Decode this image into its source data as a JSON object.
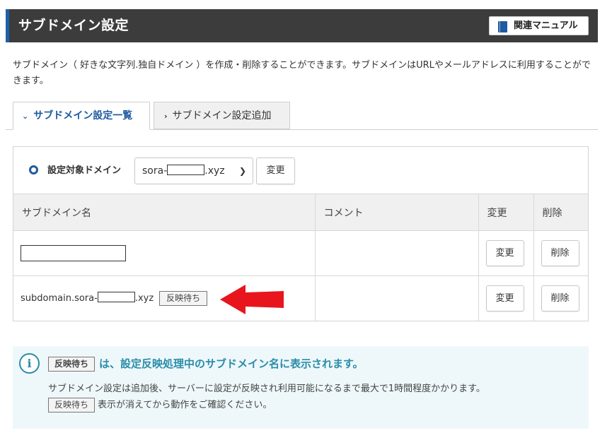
{
  "header": {
    "title": "サブドメイン設定",
    "manual_label": "関連マニュアル"
  },
  "description": "サブドメイン（ 好きな文字列.独自ドメイン ）を作成・削除することができます。サブドメインはURLやメールアドレスに利用することができます。",
  "tabs": [
    {
      "label": "サブドメイン設定一覧",
      "active": true
    },
    {
      "label": "サブドメイン設定追加",
      "active": false
    }
  ],
  "domain_selector": {
    "label": "設定対象ドメイン",
    "value_prefix": "sora-",
    "value_suffix": ".xyz",
    "change_label": "変更"
  },
  "table": {
    "headers": [
      "サブドメイン名",
      "コメント",
      "変更",
      "削除"
    ],
    "rows": [
      {
        "name_prefix": "",
        "name_suffix": "",
        "comment": "",
        "change": "変更",
        "delete": "削除",
        "pending": ""
      },
      {
        "name_prefix": "subdomain.sora-",
        "name_suffix": ".xyz",
        "comment": "",
        "change": "変更",
        "delete": "削除",
        "pending": "反映待ち"
      }
    ]
  },
  "info": {
    "badge": "反映待ち",
    "heading": "は、設定反映処理中のサブドメイン名に表示されます。",
    "line1": "サブドメイン設定は追加後、サーバーに設定が反映され利用可能になるまで最大で1時間程度かかります。",
    "line2": "表示が消えてから動作をご確認ください。"
  },
  "colors": {
    "header_bg": "#3c3c3c",
    "accent": "#1e5aa0",
    "info_text": "#2a8ca8",
    "arrow": "#e8161c"
  }
}
